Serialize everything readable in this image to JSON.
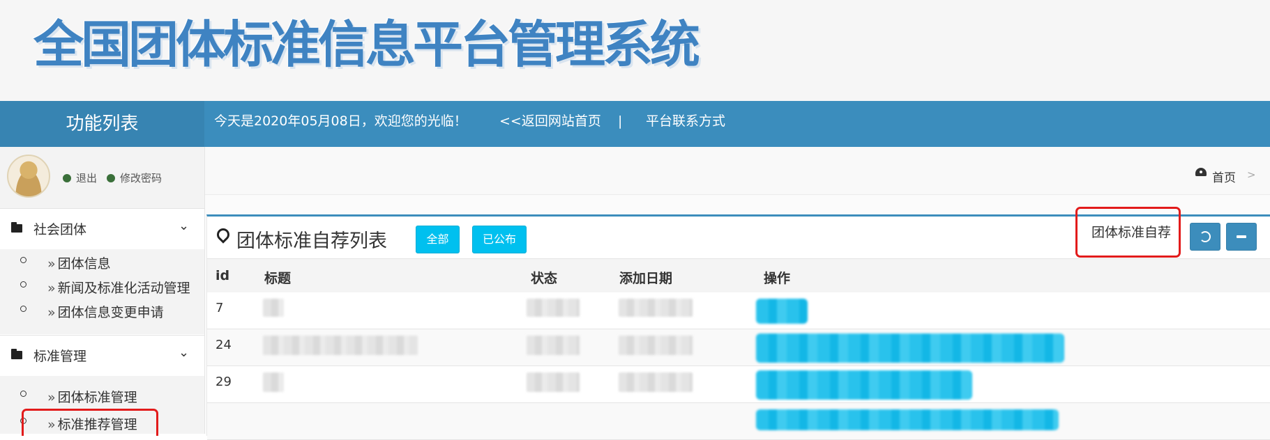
{
  "header": {
    "title": "全国团体标准信息平台管理系统"
  },
  "navbar": {
    "function_list": "功能列表",
    "date_greeting": "今天是2020年05月08日，欢迎您的光临！",
    "back_home": "<<返回网站首页",
    "separator": "|",
    "contact": "平台联系方式"
  },
  "user": {
    "logout": "退出",
    "change_password": "修改密码"
  },
  "sidebar": {
    "groups": [
      {
        "label": "社会团体",
        "items": [
          "团体信息",
          "新闻及标准化活动管理",
          "团体信息变更申请"
        ]
      },
      {
        "label": "标准管理",
        "items": [
          "团体标准管理",
          "标准推荐管理"
        ]
      }
    ],
    "item_prefix": "»"
  },
  "breadcrumb": {
    "home": "首页",
    "sep": ">"
  },
  "panel": {
    "title": "团体标准自荐列表",
    "filter_all": "全部",
    "filter_published": "已公布",
    "self_recommend": "团体标准自荐"
  },
  "table": {
    "headers": [
      "id",
      "标题",
      "状态",
      "添加日期",
      "操作"
    ],
    "rows": [
      {
        "id": "7"
      },
      {
        "id": "24"
      },
      {
        "id": "29"
      }
    ]
  },
  "colors": {
    "brand_blue": "#3b8dbd",
    "info_button": "#00c0ef",
    "highlight_red": "#e21b1b"
  },
  "icons": [
    "folder-icon",
    "chevron-down-icon",
    "circle-bullet-icon",
    "dashboard-icon",
    "map-pin-icon",
    "refresh-icon",
    "minus-icon"
  ]
}
